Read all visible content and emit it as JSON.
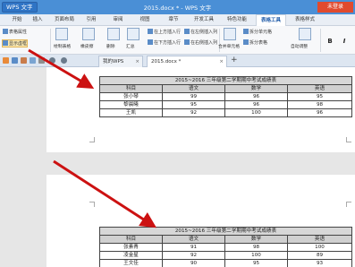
{
  "titlebar": {
    "app_name": "WPS 文字",
    "title": "2015.docx * - WPS 文字",
    "login": "未登录"
  },
  "menu": {
    "tabs": [
      "开始",
      "插入",
      "页面布局",
      "引用",
      "审阅",
      "视图",
      "章节",
      "开发工具",
      "特色功能",
      "表格工具",
      "表格样式"
    ],
    "active": "表格工具"
  },
  "ribbon": {
    "table_props": "表格属性",
    "show_gridlines": "显示虚框",
    "draw_table": "绘制表格",
    "eraser": "橡皮擦",
    "delete": "删除",
    "summary": "汇总",
    "insert_above": "在上方插入行",
    "insert_below": "在下方插入行",
    "insert_left": "在左侧插入列",
    "insert_right": "在右侧插入列",
    "merge_cells": "合并单元格",
    "split_cells": "拆分单元格",
    "split_table": "拆分表格",
    "auto_fit": "自动调整",
    "bold": "B",
    "italic": "I"
  },
  "tabs": {
    "my_wps": "我的WPS",
    "doc": "2015.docx *",
    "plus": "+"
  },
  "table1": {
    "title": "2015~2016 三年级第二学期期中考试成绩表",
    "headers": [
      "科目",
      "语文",
      "数学",
      "英语"
    ],
    "rows": [
      [
        "张小琴",
        "99",
        "96",
        "95"
      ],
      [
        "黎晨曦",
        "95",
        "96",
        "98"
      ],
      [
        "王凯",
        "92",
        "100",
        "96"
      ]
    ]
  },
  "table2": {
    "title": "2015~2016 三年级第二学期期中考试成绩表",
    "headers": [
      "科目",
      "语文",
      "数学",
      "英语"
    ],
    "rows": [
      [
        "张素青",
        "91",
        "98",
        "100"
      ],
      [
        "凌金星",
        "92",
        "100",
        "89"
      ],
      [
        "王文佳",
        "90",
        "95",
        "93"
      ]
    ]
  },
  "colors": {
    "titlebar": "#4a8fd6",
    "login": "#e04a2e",
    "arrow": "#cc1111"
  }
}
